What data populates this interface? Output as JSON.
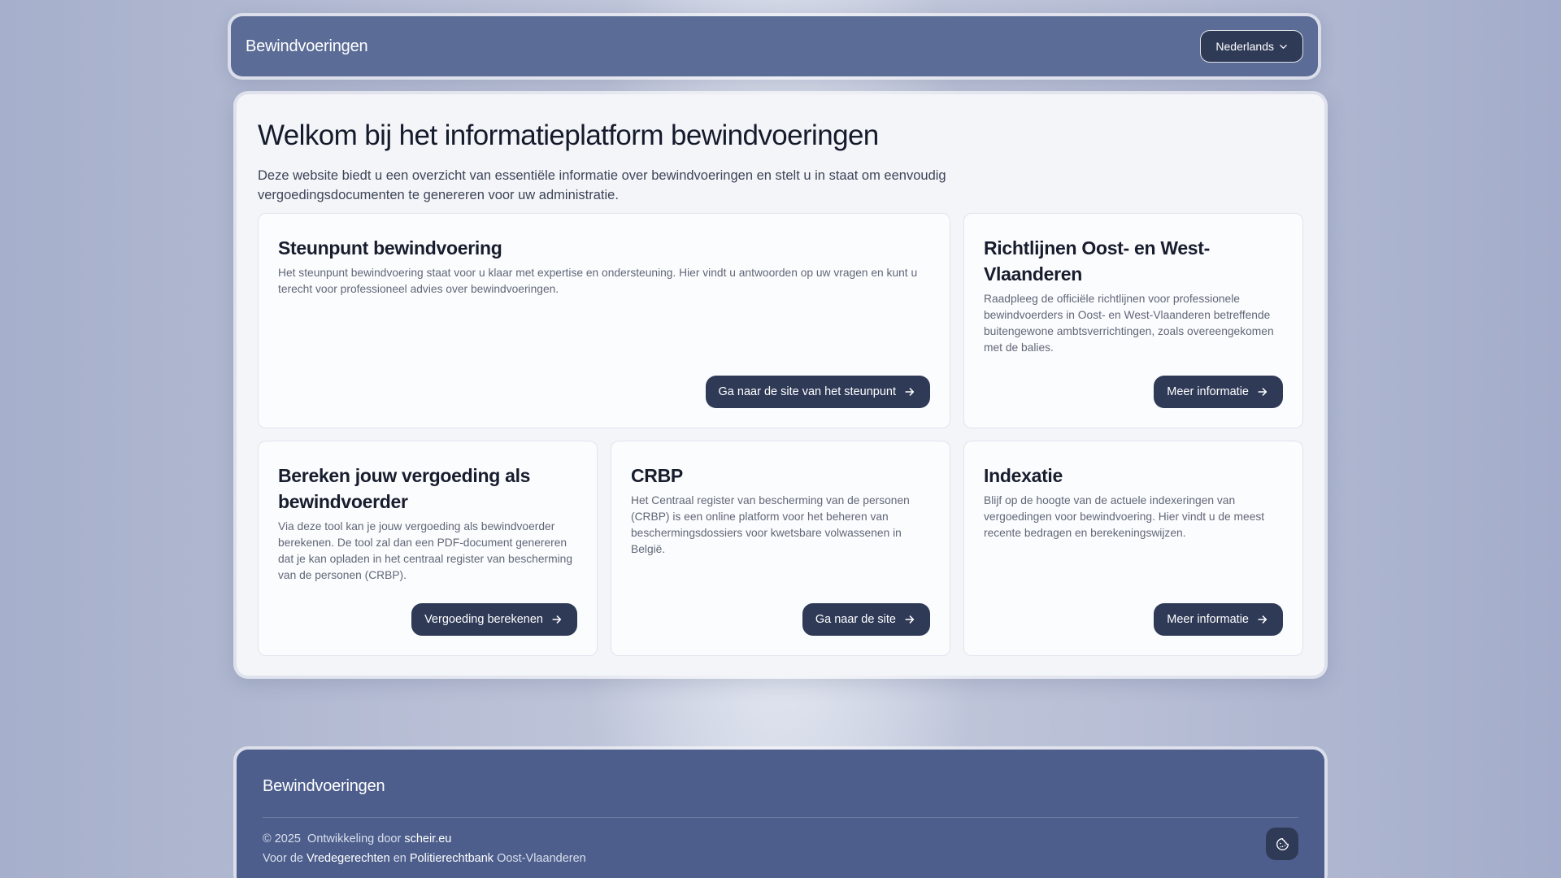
{
  "header": {
    "brand": "Bewindvoeringen",
    "language": {
      "selected": "Nederlands",
      "icon": "chevron-down-icon"
    }
  },
  "main": {
    "title": "Welkom bij het informatieplatform bewindvoeringen",
    "intro": "Deze website biedt u een overzicht van essentiële informatie over bewindvoeringen en stelt u in staat om eenvoudig vergoedingsdocumenten te genereren voor uw administratie.",
    "cards": [
      {
        "title": "Steunpunt bewindvoering",
        "description": "Het steunpunt bewindvoering staat voor u klaar met expertise en ondersteuning. Hier vindt u antwoorden op uw vragen en kunt u terecht voor professioneel advies over bewindvoeringen.",
        "button": "Ga naar de site van het steunpunt"
      },
      {
        "title": "Richtlijnen Oost- en West-Vlaanderen",
        "description": "Raadpleeg de officiële richtlijnen voor professionele bewindvoerders in Oost- en West-Vlaanderen betreffende buitengewone ambtsverrichtingen, zoals overeengekomen met de balies.",
        "button": "Meer informatie"
      },
      {
        "title": "Bereken jouw vergoeding als bewindvoerder",
        "description": "Via deze tool kan je jouw vergoeding als bewindvoerder berekenen. De tool zal dan een PDF-document genereren dat je kan opladen in het centraal register van bescherming van de personen (CRBP).",
        "button": "Vergoeding berekenen"
      },
      {
        "title": "CRBP",
        "description": "Het Centraal register van bescherming van de personen (CRBP) is een online platform voor het beheren van beschermingsdossiers voor kwetsbare volwassenen in België.",
        "button": "Ga naar de site"
      },
      {
        "title": "Indexatie",
        "description": "Blijf op de hoogte van de actuele indexeringen van vergoedingen voor bewindvoering. Hier vindt u de meest recente bedragen en berekeningswijzen.",
        "button": "Meer informatie"
      }
    ],
    "button_icon": "arrow-right-icon"
  },
  "footer": {
    "brand": "Bewindvoeringen",
    "copyright": "© 2025",
    "developed_by_label": "Ontwikkeling door",
    "developer": "scheir.eu",
    "for_label": "Voor de",
    "court1": "Vredegerechten",
    "and_label": "en",
    "court2": "Politierechtbank",
    "region": "Oost-Vlaanderen",
    "cookie_icon": "cookie-icon"
  },
  "colors": {
    "header_bg": "#5b6c97",
    "footer_bg": "#4d5e8c",
    "button_bg": "#2f3a57",
    "card_bg": "#fbfcfe",
    "panel_bg": "#f3f5f9"
  }
}
